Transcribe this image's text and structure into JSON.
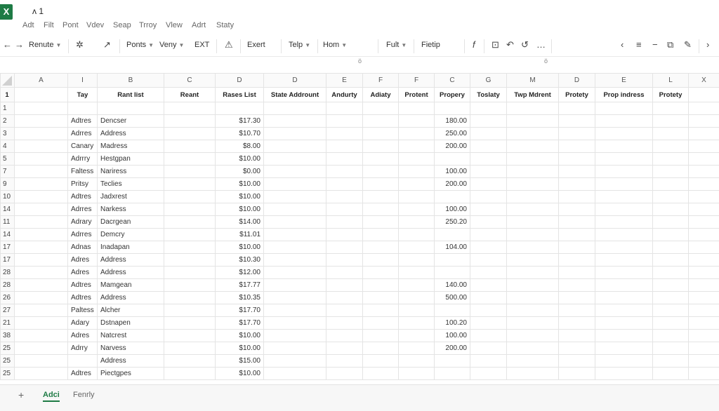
{
  "app": {
    "logo": "X",
    "title": "ᴧ 1"
  },
  "menu": [
    "Adt",
    "Filt",
    "Pont",
    "Vdev",
    "Seap",
    "Trroy",
    "Vlew",
    "Adrt",
    "Staty"
  ],
  "toolbar": {
    "back_icon": "arrow-left-icon",
    "forward_icon": "arrow-right-icon",
    "renute": "Renute",
    "brush_glyph": "✲",
    "arrow_glyph": "↗",
    "ponts": "Ponts",
    "veny": "Veny",
    "ext": "EXT",
    "warn_glyph": "⚠",
    "exert": "Exert",
    "telp": "Telp",
    "hom": "Hom",
    "fult": "Fult",
    "fietip": "Fietip",
    "f_glyph": "f",
    "right_glyphs": [
      "⊡",
      "↶",
      "↺",
      "…"
    ],
    "far_right_glyphs": [
      "‹",
      "≡",
      "−",
      "⧉",
      "✎",
      "›"
    ],
    "sub_marks": [
      "ö",
      "ö"
    ]
  },
  "grid": {
    "columns": [
      "",
      "A",
      "I",
      "B",
      "C",
      "D",
      "D",
      "E",
      "F",
      "F",
      "C",
      "G",
      "M",
      "D",
      "E",
      "L",
      "X"
    ],
    "headers": [
      "1",
      "",
      "Tay",
      "Rant list",
      "Reant",
      "Rases List",
      "State Addrount",
      "Andurty",
      "Adiaty",
      "Protent",
      "Propery",
      "Toslaty",
      "Twp Mdrent",
      "Protety",
      "Prop indress",
      "Protety",
      ""
    ],
    "rows": [
      {
        "n": "1",
        "b": "",
        "c": "",
        "f": "",
        "k": ""
      },
      {
        "n": "2",
        "b": "Adtres",
        "c": "Dencser",
        "f": "$17.30",
        "k": "180.00"
      },
      {
        "n": "3",
        "b": "Adrres",
        "c": "Address",
        "f": "$10.70",
        "k": "250.00"
      },
      {
        "n": "4",
        "b": "Canary",
        "c": "Madress",
        "f": "$8.00",
        "k": "200.00"
      },
      {
        "n": "5",
        "b": "Adrrry",
        "c": "Hestgpan",
        "f": "$10.00",
        "k": ""
      },
      {
        "n": "7",
        "b": "Faltess",
        "c": "Nariress",
        "f": "$0.00",
        "k": "100.00"
      },
      {
        "n": "9",
        "b": "Pritsy",
        "c": "Teclies",
        "f": "$10.00",
        "k": "200.00"
      },
      {
        "n": "10",
        "b": "Adtres",
        "c": "Jadxrest",
        "f": "$10.00",
        "k": ""
      },
      {
        "n": "14",
        "b": "Adrres",
        "c": "Narkess",
        "f": "$10.00",
        "k": "100.00"
      },
      {
        "n": "11",
        "b": "Adrary",
        "c": "Dacrgean",
        "f": "$14.00",
        "k": "250.20"
      },
      {
        "n": "14",
        "b": "Adrres",
        "c": "Demcry",
        "f": "$11.01",
        "k": ""
      },
      {
        "n": "17",
        "b": "Adnas",
        "c": "Inadapan",
        "f": "$10.00",
        "k": "104.00"
      },
      {
        "n": "17",
        "b": "Adres",
        "c": "Address",
        "f": "$10.30",
        "k": ""
      },
      {
        "n": "28",
        "b": "Adres",
        "c": "Address",
        "f": "$12.00",
        "k": ""
      },
      {
        "n": "28",
        "b": "Adtres",
        "c": "Mamgean",
        "f": "$17.77",
        "k": "140.00"
      },
      {
        "n": "26",
        "b": "Adtres",
        "c": "Address",
        "f": "$10.35",
        "k": "500.00"
      },
      {
        "n": "27",
        "b": "Paltess",
        "c": "Alcher",
        "f": "$17.70",
        "k": ""
      },
      {
        "n": "21",
        "b": "Adary",
        "c": "Dstnapen",
        "f": "$17.70",
        "k": "100.20"
      },
      {
        "n": "38",
        "b": "Adres",
        "c": "Natcrest",
        "f": "$10.00",
        "k": "100.00"
      },
      {
        "n": "25",
        "b": "Adrry",
        "c": "Narvess",
        "f": "$10.00",
        "k": "200.00"
      },
      {
        "n": "25",
        "b": "",
        "c": "Address",
        "f": "$15.00",
        "k": ""
      },
      {
        "n": "25",
        "b": "Adtres",
        "c": "Piectgpes",
        "f": "$10.00",
        "k": ""
      }
    ]
  },
  "sheets": {
    "add_glyph": "+",
    "tabs": [
      "Adci",
      "Fenrly"
    ],
    "active": 0
  },
  "colors": {
    "accent": "#1e7b45",
    "grid_line": "#e4e4e4"
  }
}
